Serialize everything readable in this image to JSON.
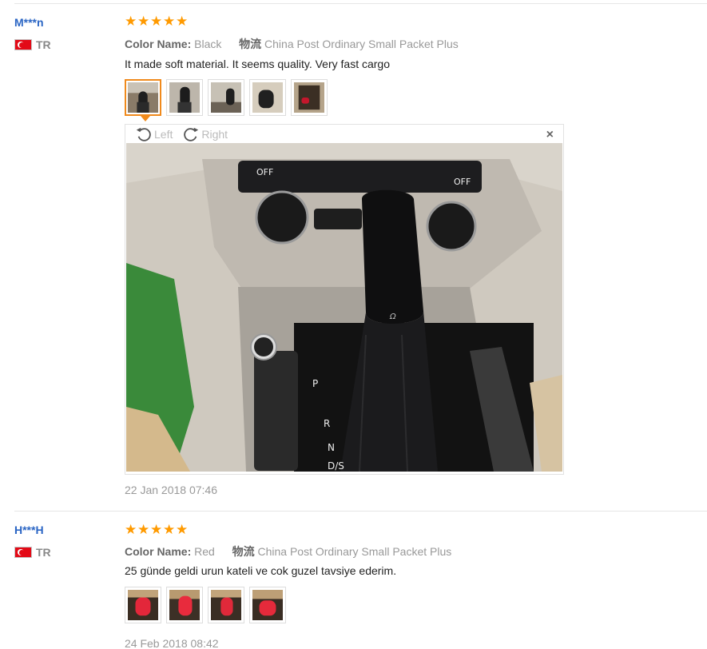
{
  "reviews": [
    {
      "user": "M***n",
      "country": "TR",
      "rating": 5,
      "color_label": "Color Name:",
      "color_value": "Black",
      "ship_label": "物流",
      "ship_value": "China Post Ordinary Small Packet Plus",
      "text": "It made soft material. It seems quality. Very fast cargo",
      "thumb_count": 5,
      "viewer": {
        "left_label": "Left",
        "right_label": "Right",
        "close_label": "×"
      },
      "date": "22 Jan 2018 07:46"
    },
    {
      "user": "H***H",
      "country": "TR",
      "rating": 5,
      "color_label": "Color Name:",
      "color_value": "Red",
      "ship_label": "物流",
      "ship_value": "China Post Ordinary Small Packet Plus",
      "text": "25 günde geldi urun kateli ve cok guzel tavsiye ederim.",
      "thumb_count": 4,
      "date": "24 Feb 2018 08:42"
    }
  ],
  "colors": {
    "accent": "#ff9a00",
    "user": "#2a65c4",
    "active_border": "#f08a1c"
  },
  "icons": {
    "star": "star-icon",
    "rotate_left": "rotate-left-icon",
    "rotate_right": "rotate-right-icon",
    "close": "close-icon",
    "flag": "turkey-flag-icon"
  }
}
